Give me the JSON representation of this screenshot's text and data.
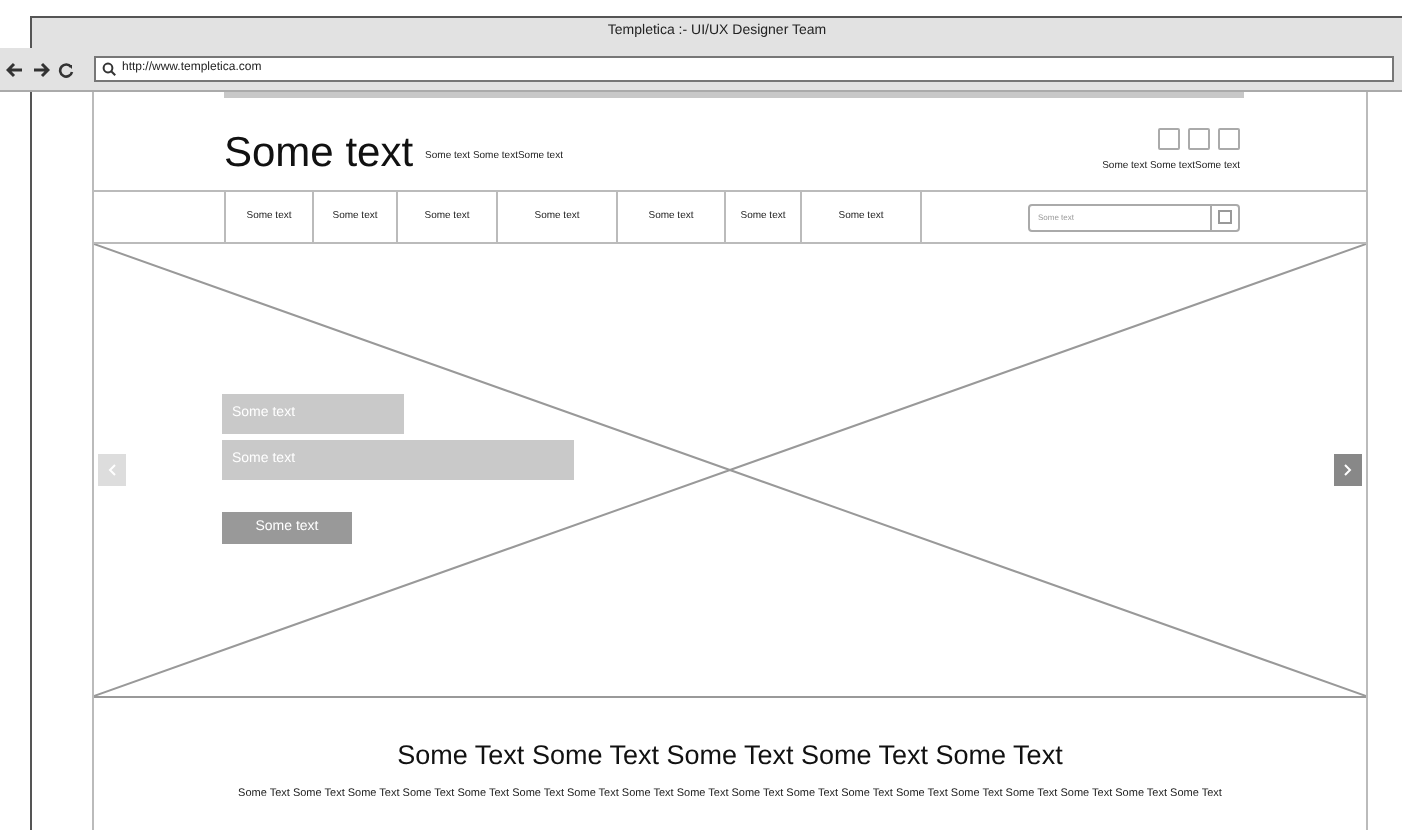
{
  "window": {
    "title": "Templetica :- UI/UX Designer Team"
  },
  "address_bar": {
    "url": "http://www.templetica.com"
  },
  "header": {
    "title": "Some text",
    "tagline": "Some text Some textSome text",
    "right_text": "Some text Some textSome text"
  },
  "nav": {
    "items": [
      {
        "label": "Some text"
      },
      {
        "label": "Some text"
      },
      {
        "label": "Some text"
      },
      {
        "label": "Some text"
      },
      {
        "label": "Some text"
      },
      {
        "label": "Some text"
      },
      {
        "label": "Some text"
      }
    ],
    "search": {
      "placeholder": "Some text"
    }
  },
  "hero": {
    "lines": [
      "Some text",
      "Some text"
    ],
    "button": "Some text"
  },
  "section": {
    "heading": "Some Text Some Text Some Text Some Text Some Text",
    "paragraph": "Some Text Some Text Some Text Some Text Some Text Some Text Some Text Some Text Some Text Some Text Some Text Some Text Some Text Some Text Some Text Some Text Some Text Some Text"
  }
}
